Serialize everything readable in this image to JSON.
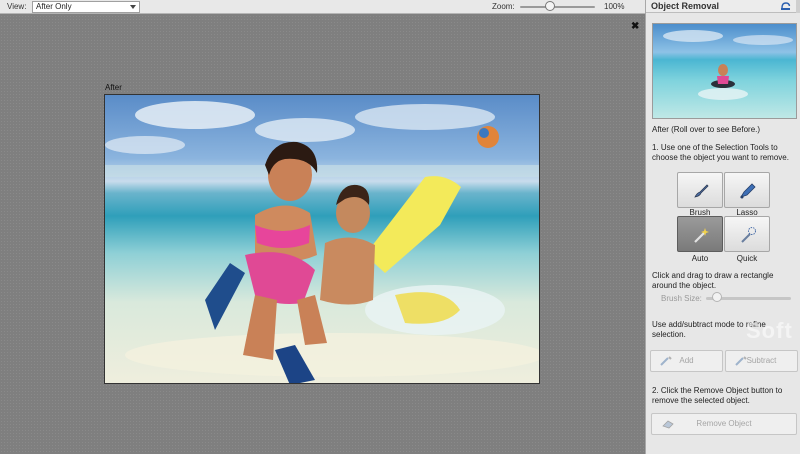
{
  "toolbar": {
    "view_label": "View:",
    "view_value": "After Only",
    "zoom_label": "Zoom:",
    "zoom_value": "100%",
    "zoom_level_percent": 100
  },
  "canvas": {
    "close_symbol": "✖",
    "image_caption": "After"
  },
  "panel": {
    "title": "Object Removal",
    "reset_icon": "reset-icon",
    "thumbnail_caption": "After (Roll over to see Before.)",
    "step1": "1. Use one of the Selection Tools to choose the object you want to remove.",
    "tools": [
      {
        "label": "Brush",
        "icon": "brush-icon",
        "active": false
      },
      {
        "label": "Lasso",
        "icon": "lasso-icon",
        "active": false
      },
      {
        "label": "Auto",
        "icon": "magic-wand-icon",
        "active": true
      },
      {
        "label": "Quick",
        "icon": "quick-selection-icon",
        "active": false
      }
    ],
    "hint": "Click and drag to draw a rectangle around the object.",
    "brush_size_label": "Brush Size:",
    "refine": "Use add/subtract mode to refine selection.",
    "add_label": "Add",
    "subtract_label": "Subtract",
    "step2": "2. Click the Remove Object button to remove the selected object.",
    "remove_label": "Remove Object",
    "watermark": "Soft"
  },
  "colors": {
    "panel_bg": "#e7e7e7",
    "canvas_bg": "#7f7f7f",
    "active_tool": "#858585"
  }
}
